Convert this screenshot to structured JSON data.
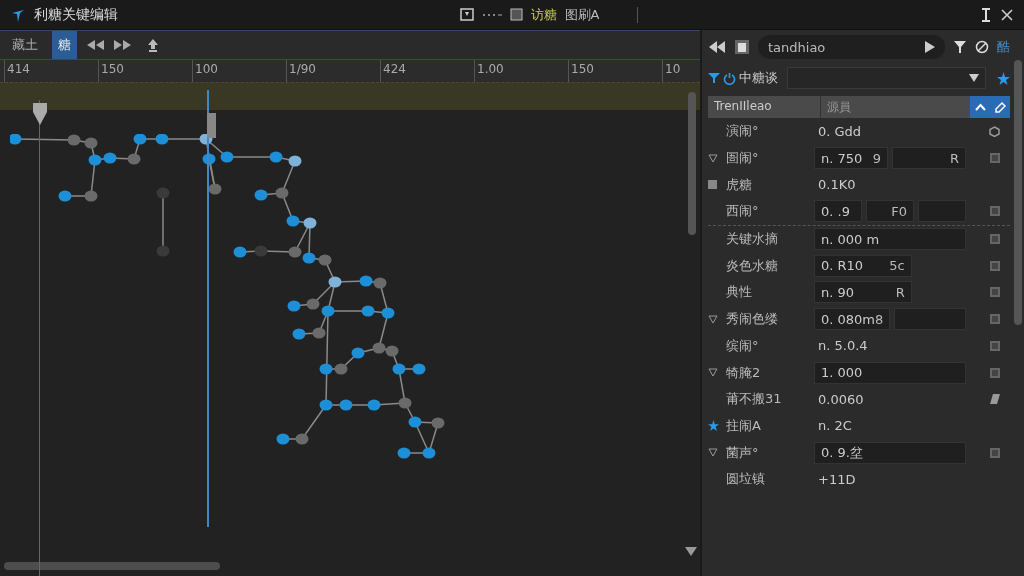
{
  "window": {
    "title": "利糖关键编辑",
    "header_items": [
      "访糖",
      "图刷A"
    ]
  },
  "toolbar": {
    "buttons": [
      {
        "label": "藏土",
        "selected": false
      },
      {
        "label": "糖",
        "selected": true
      }
    ]
  },
  "ruler": {
    "labels": [
      "414",
      "150",
      "100",
      "1/90",
      "424",
      "1.00",
      "150",
      "10"
    ]
  },
  "inspector": {
    "search": {
      "value": "tandhiao"
    },
    "badge": "酷",
    "filter": {
      "label": "中糖谈"
    },
    "table_header": {
      "column_1": "TrenIIleao",
      "column_2": "源員"
    },
    "rows": [
      {
        "label": "演闹°",
        "cells": [
          {
            "kind": "plain",
            "text": "0. Gdd"
          }
        ]
      },
      {
        "label": "圄闹°",
        "cells": [
          {
            "kind": "field",
            "text": "n. 750",
            "unit": "9"
          },
          {
            "kind": "field",
            "unit": "R"
          }
        ]
      },
      {
        "label": "虎糖",
        "cells": [
          {
            "kind": "plain",
            "text": "0.1K0"
          }
        ]
      },
      {
        "label": "西闹°",
        "cells": [
          {
            "kind": "field",
            "text": "0. .9"
          },
          {
            "kind": "field",
            "unit": "F0"
          },
          {
            "kind": "field"
          }
        ]
      },
      {
        "label": "关键水摘",
        "cells": [
          {
            "kind": "field",
            "text": "n. 000 m"
          }
        ]
      },
      {
        "label": "炎色水糖",
        "cells": [
          {
            "kind": "field",
            "text": "0. R10",
            "unit": "5c"
          },
          {
            "kind": "gap"
          }
        ]
      },
      {
        "label": "典性",
        "cells": [
          {
            "kind": "field",
            "text": "n. 90",
            "unit": "R"
          },
          {
            "kind": "gap"
          }
        ]
      },
      {
        "label": "秀闹色缕",
        "cells": [
          {
            "kind": "field",
            "text": "0. 080m",
            "unit": "8"
          },
          {
            "kind": "field"
          }
        ]
      },
      {
        "label": "缤闹°",
        "cells": [
          {
            "kind": "plain",
            "text": "n. 5.0.4"
          }
        ]
      },
      {
        "label": "犄腌2",
        "cells": [
          {
            "kind": "field",
            "text": "1. 000"
          }
        ]
      },
      {
        "label": "莆不搬31",
        "cells": [
          {
            "kind": "plain",
            "text": "0.0060"
          }
        ]
      },
      {
        "label": "拄闹A",
        "cells": [
          {
            "kind": "plain",
            "text": "n. 2C"
          }
        ]
      },
      {
        "label": "菌声°",
        "cells": [
          {
            "kind": "field",
            "text": "0. 9.坌"
          }
        ]
      },
      {
        "label": "圆垃镇",
        "cells": [
          {
            "kind": "plain",
            "text": "+11D"
          }
        ]
      }
    ]
  }
}
